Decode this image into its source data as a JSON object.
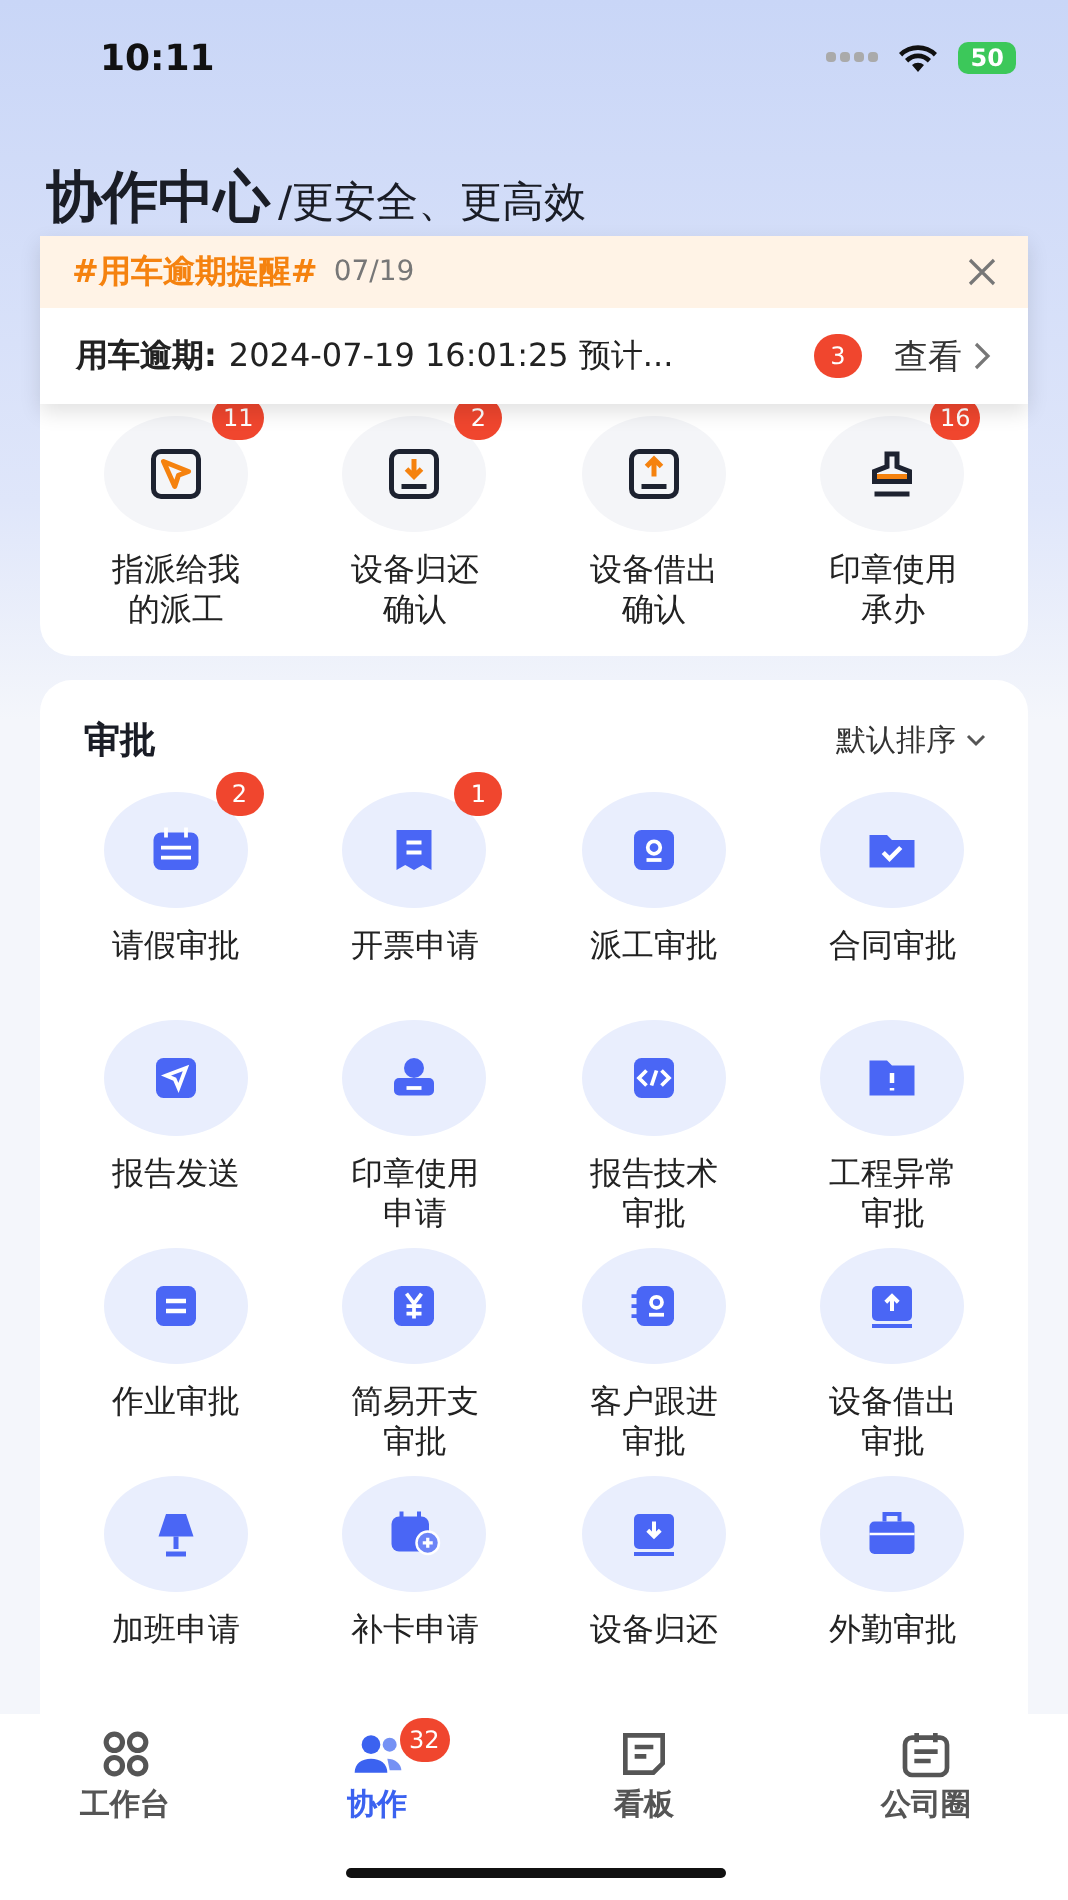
{
  "status_bar": {
    "time": "10:11",
    "battery": "50"
  },
  "header": {
    "title": "协作中心",
    "subtitle": "/更安全、更高效"
  },
  "notice": {
    "tag": "#用车逾期提醒#",
    "date": "07/19",
    "label": "用车逾期:",
    "text": "2024-07-19 16:01:25 预计...",
    "count": "3",
    "action": "查看"
  },
  "todo": [
    {
      "label": "指派给我的派工",
      "badge": "11"
    },
    {
      "label": "设备归还确认",
      "badge": "2"
    },
    {
      "label": "设备借出确认"
    },
    {
      "label": "印章使用承办",
      "badge": "16"
    }
  ],
  "approval": {
    "title": "审批",
    "sort": "默认排序",
    "items": [
      {
        "label": "请假审批",
        "badge": "2"
      },
      {
        "label": "开票申请",
        "badge": "1"
      },
      {
        "label": "派工审批"
      },
      {
        "label": "合同审批"
      },
      {
        "label": "报告发送"
      },
      {
        "label": "印章使用申请"
      },
      {
        "label": "报告技术审批"
      },
      {
        "label": "工程异常审批"
      },
      {
        "label": "作业审批"
      },
      {
        "label": "简易开支审批"
      },
      {
        "label": "客户跟进审批"
      },
      {
        "label": "设备借出审批"
      },
      {
        "label": "加班申请"
      },
      {
        "label": "补卡申请"
      },
      {
        "label": "设备归还"
      },
      {
        "label": "外勤审批"
      }
    ]
  },
  "tab_bar": [
    {
      "label": "工作台",
      "selected": false
    },
    {
      "label": "协作",
      "selected": true,
      "badge": "32"
    },
    {
      "label": "看板",
      "selected": false
    },
    {
      "label": "公司圈",
      "selected": false
    }
  ]
}
